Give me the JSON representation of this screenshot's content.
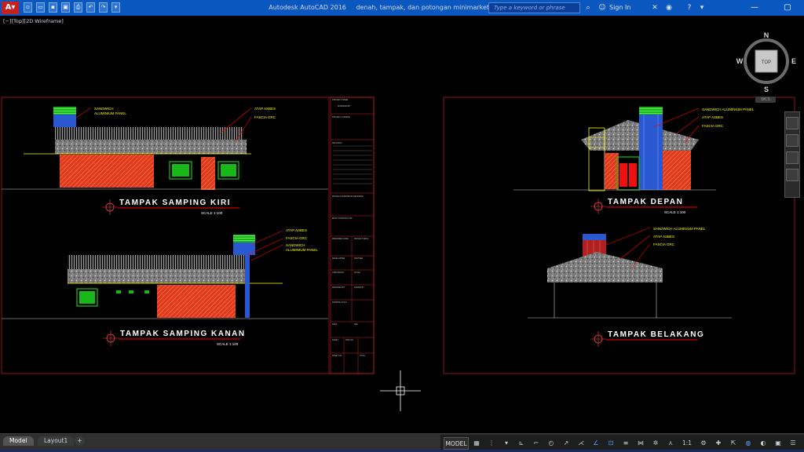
{
  "titlebar": {
    "app_name": "Autodesk AutoCAD 2016",
    "file_name": "denah, tampak, dan potongan minimarket - asdar.id.dwg",
    "search_placeholder": "Type a keyword or phrase",
    "sign_in": "Sign In"
  },
  "viewport": {
    "label": "[−][Top][2D Wireframe]",
    "viewcube": {
      "n": "N",
      "s": "S",
      "e": "E",
      "w": "W",
      "top": "TOP",
      "wcs": "WCS"
    }
  },
  "drawing": {
    "left_sheet": {
      "kiri": {
        "title": "TAMPAK SAMPING KIRI",
        "scale": "SCALE 1:100",
        "notes": [
          "SANDWICH",
          "ALUMINIUM PANEL",
          "ATAP ASBES",
          "FASCIA GRC"
        ]
      },
      "kanan": {
        "title": "TAMPAK SAMPING KANAN",
        "scale": "SCALE 1:100",
        "notes": [
          "ATAP ASBES",
          "FASCIA GRC",
          "SANDWICH",
          "ALUMINIUM PANEL"
        ]
      },
      "title_block": {
        "rows": [
          "PROJECT NAME",
          "MINIMARKET",
          "PROJECT OWNER",
          "REVISION",
          "PROJECT ADMIN/BUSA DESIGNER",
          "MAIN CONTRACTOR",
          "PREPARED NAME",
          "PROJECT DESC.",
          "DEVELOPPER",
          "PARTNER",
          "CHECKED BY",
          "SCALE",
          "DESIGNED BY",
          "DRAWN BY",
          "DRAWING TITLE",
          "DATE",
          "REV.",
          "SHEET",
          "DWG NO.",
          "SHEET NO.",
          "TOTAL"
        ]
      }
    },
    "right_sheet": {
      "depan": {
        "title": "TAMPAK DEPAN",
        "scale": "SCALE 1:100",
        "notes": [
          "SANDWICH ALUMINIUM PANEL",
          "ATAP ASBES",
          "FASCIA GRC"
        ]
      },
      "belakang": {
        "title": "TAMPAK BELAKANG",
        "notes": [
          "SANDWICH ALUMINIUM PANEL",
          "ATAP ASBES",
          "FASCIA GRC"
        ]
      }
    }
  },
  "layout_tabs": [
    "Model",
    "Layout1",
    "+"
  ],
  "status_bar": {
    "model_label": "MODEL",
    "annotation_scale": "1:1"
  },
  "colors": {
    "accent": "#0b57c0",
    "roof": "#8a8a8a",
    "brick": "#e03a1a",
    "panel": "#18b818",
    "note": "#ffff00",
    "leader": "#ff0000",
    "frame": "#cc2020"
  }
}
